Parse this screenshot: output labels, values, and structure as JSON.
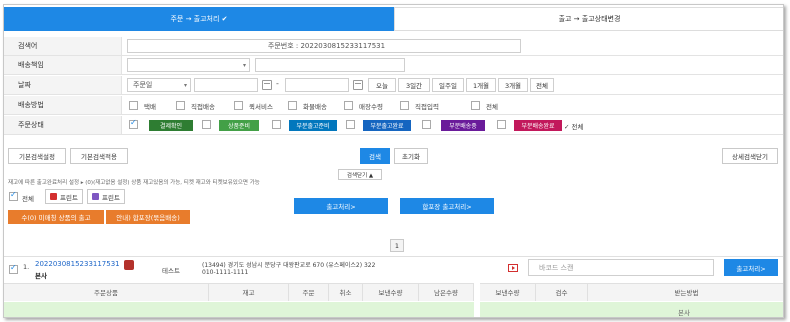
{
  "tabs": {
    "active_label": "주문 → 출고처리 ✔",
    "inactive_label": "출고 → 출고상태변경"
  },
  "search": {
    "keyword_label": "검색어",
    "keyword_value": "주문번호 : 2022030815233117531",
    "shipper_label": "배송책임",
    "date_label": "날짜",
    "date_type": "주문일",
    "date_separator": "-",
    "date_buttons": [
      "오늘",
      "3일간",
      "일주일",
      "1개월",
      "3개월",
      "전체"
    ],
    "shipping_label": "배송방법",
    "shipping_options": [
      "택배",
      "직접배송",
      "퀵서비스",
      "화물배송",
      "매장수령",
      "직접입력",
      "전체"
    ],
    "status_label": "주문상태",
    "status_options": [
      {
        "label": "결제확인",
        "color": "#2e7d32"
      },
      {
        "label": "상품준비",
        "color": "#43a047"
      },
      {
        "label": "부분출고준비",
        "color": "#0277bd"
      },
      {
        "label": "부분출고완료",
        "color": "#1565c0"
      },
      {
        "label": "부분배송중",
        "color": "#6a1b9a"
      },
      {
        "label": "부분배송완료",
        "color": "#c2185b"
      }
    ],
    "status_all": "✓ 전체"
  },
  "actions": {
    "basic_setting": "기본검색설정",
    "basic_apply": "기본검색적용",
    "search": "검색",
    "reset": "초기화",
    "detail_close": "상세검색닫기",
    "search_close": "검색닫기 ▲"
  },
  "toolbar": {
    "notice": "재고에 따른 출고완료처리 설정 ▸  (0)(재고없음 설정) 상품 재고있음의 가능,  티켓 재고와 티켓보유있으면 가능",
    "all_label": "전체",
    "print1": "프린트",
    "print2": "프린트",
    "process_btn": "출고처리>",
    "package_btn": "합포장 출고처리>",
    "orange1": "수(0) 미매칭 상품의 출고",
    "orange2": "안내) 합포장(묶음배송)"
  },
  "pagination": {
    "current": "1"
  },
  "order": {
    "index": "1.",
    "order_no": "2022030815233117531",
    "store": "본사",
    "buyer": "테스트",
    "address": "(13494) 경기도 성남시 분당구 대왕판교로 670 (유스페이스2) 322",
    "phone": "010-1111-1111",
    "barcode_placeholder": "바코드 스캔",
    "process_btn": "출고처리>"
  },
  "table": {
    "left_headers": [
      "주문상품",
      "재고",
      "주문",
      "취소",
      "보낸수량",
      "남은수량"
    ],
    "right_headers": [
      "보낸수량",
      "검수",
      "받는방법"
    ],
    "green_text": "본사"
  }
}
